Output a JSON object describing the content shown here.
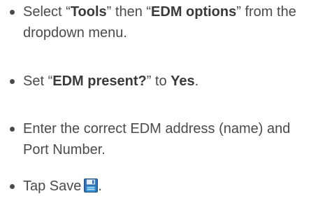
{
  "steps": [
    {
      "t1": "Select “",
      "b1": "Tools",
      "t2": "” then “",
      "b2": "EDM options",
      "t3": "” from the dropdown menu."
    },
    {
      "t1": "Set “",
      "b1": "EDM present?",
      "t2": "” to ",
      "b2": "Yes",
      "t3": "."
    },
    {
      "t1": "Enter the correct EDM address (name) and Port Number."
    },
    {
      "t1": "Tap Save",
      "t2": ".",
      "icon": "save-floppy-icon"
    }
  ]
}
